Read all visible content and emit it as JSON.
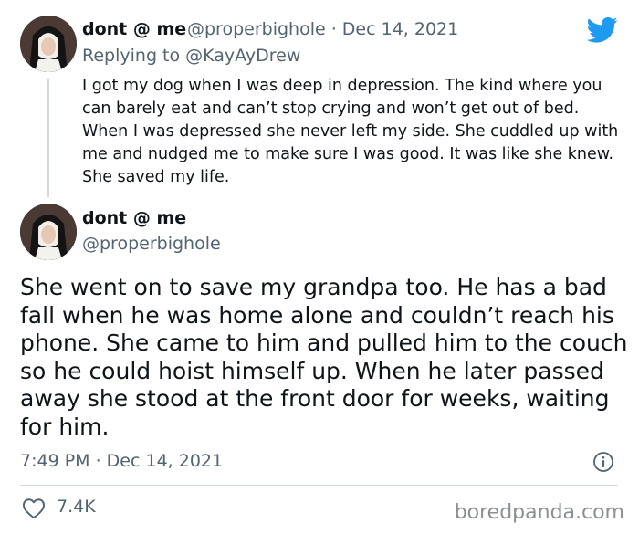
{
  "reply_tweet": {
    "display_name": "dont @ me",
    "handle_date": "@properbighole · Dec 14, 2021",
    "replying_to": "Replying to @KayAyDrew",
    "text": "I got my dog when I was deep in depression. The kind where you can barely eat and can’t stop crying and won’t get out of bed. When I was depressed she never left my side. She cuddled up with me and nudged me to make sure I was good. It was like she knew. She saved my life."
  },
  "main_tweet": {
    "display_name": "dont @ me",
    "handle": "@properbighole",
    "text": "She went on to save my grandpa too. He has a bad fall when he was home alone and couldn’t reach his phone. She came to him and pulled him to the couch so he could hoist himself up. When he later passed away she stood at the front door for weeks, waiting for him.",
    "timestamp": "7:49 PM · Dec 14, 2021",
    "like_count": "7.4K"
  },
  "watermark": "boredpanda.com",
  "icons": {
    "brand": "twitter-bird-icon",
    "info": "info-icon",
    "like": "heart-icon"
  },
  "colors": {
    "twitter_blue": "#1d9bf0",
    "text": "#0f1419",
    "muted": "#536471",
    "divider": "#cfd9de",
    "link": "#1d9bf0"
  }
}
